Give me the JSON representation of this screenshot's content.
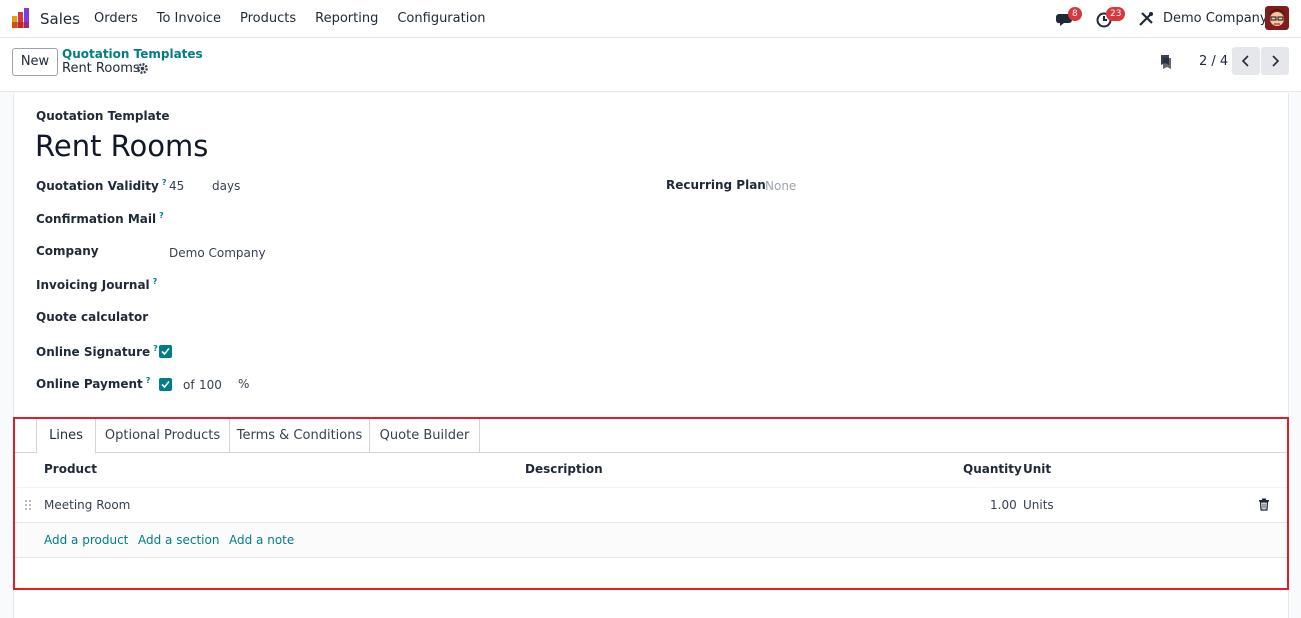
{
  "navbar": {
    "app_name": "Sales",
    "menu": [
      "Orders",
      "To Invoice",
      "Products",
      "Reporting",
      "Configuration"
    ],
    "messages_count": "8",
    "activities_count": "23",
    "company": "Demo Company"
  },
  "control": {
    "new_label": "New",
    "breadcrumb_parent": "Quotation Templates",
    "breadcrumb_current": "Rent Rooms",
    "pager": "2 / 4"
  },
  "form": {
    "header_label": "Quotation Template",
    "title": "Rent Rooms",
    "validity_label": "Quotation Validity",
    "validity_value": "45",
    "validity_unit": "days",
    "recurring_label": "Recurring Plan",
    "recurring_value": "None",
    "confirmation_label": "Confirmation Mail",
    "company_label": "Company",
    "company_value": "Demo Company",
    "journal_label": "Invoicing Journal",
    "calculator_label": "Quote calculator",
    "signature_label": "Online Signature",
    "payment_label": "Online Payment",
    "payment_of": "of",
    "payment_value": "100",
    "payment_unit": "%",
    "help_mark": "?"
  },
  "notebook": {
    "tabs": [
      "Lines",
      "Optional Products",
      "Terms & Conditions",
      "Quote Builder"
    ],
    "columns": {
      "product": "Product",
      "description": "Description",
      "quantity": "Quantity",
      "unit": "Unit"
    },
    "lines": [
      {
        "product": "Meeting Room",
        "description": "",
        "quantity": "1.00",
        "unit": "Units"
      }
    ],
    "add_product": "Add a product",
    "add_section": "Add a section",
    "add_note": "Add a note"
  },
  "colors": {
    "accent": "#017e84",
    "highlight": "#e11d28",
    "badge": "#d9363e"
  }
}
